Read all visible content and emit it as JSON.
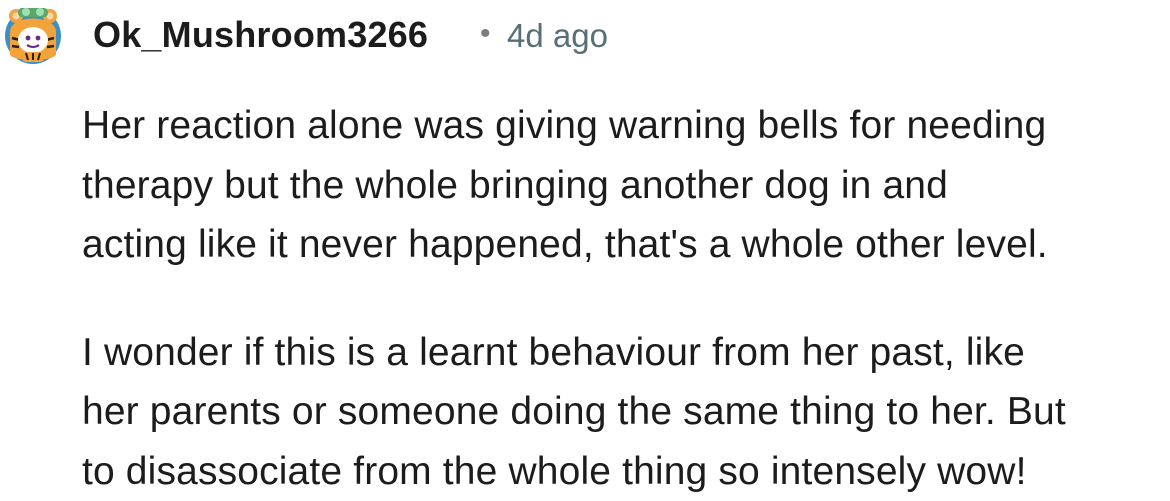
{
  "comment": {
    "author": "Ok_Mushroom3266",
    "separator": "•",
    "timestamp": "4d ago",
    "avatar_icon": "snoo-tiger-avatar-icon",
    "paragraphs": [
      {
        "lines": [
          "Her reaction alone was giving warning bells for needing",
          "therapy but the whole bringing another dog in and",
          "acting like it never happened, that's a whole other level."
        ]
      },
      {
        "lines": [
          "I wonder if this is a learnt behaviour from her past, like",
          "her parents or someone doing the same thing to her. But",
          "to disassociate from the whole thing so intensely wow!"
        ]
      }
    ]
  },
  "colors": {
    "author": "#1c1c1c",
    "timestamp": "#576f76",
    "body_text": "#1c1c1c",
    "background": "#ffffff",
    "avatar_bg": "#3e8fc6",
    "avatar_tiger": "#f2a33a"
  }
}
